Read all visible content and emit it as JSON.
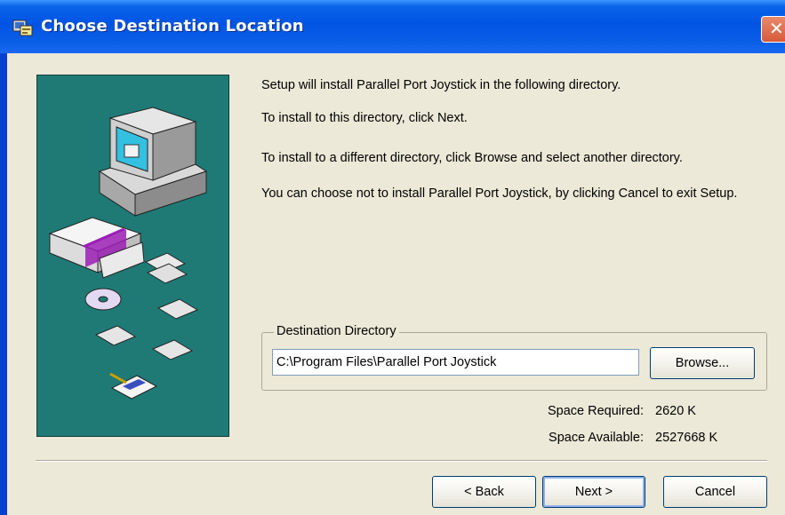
{
  "window": {
    "title": "Choose Destination Location",
    "close_glyph": "✕",
    "title_icon": "installer-icon"
  },
  "body": {
    "line1": "Setup will install Parallel Port Joystick in the following directory.",
    "line2": "To install to this directory, click Next.",
    "line3": "To install to a different directory, click Browse and select another directory.",
    "line4": "You can choose not to install Parallel Port Joystick, by clicking Cancel to exit Setup."
  },
  "destination": {
    "group_label": "Destination Directory",
    "path": "C:\\Program Files\\Parallel Port Joystick",
    "browse_label": "Browse..."
  },
  "space": {
    "required_label": "Space Required:",
    "required_value": "2620 K",
    "available_label": "Space Available:",
    "available_value": "2527668 K"
  },
  "buttons": {
    "back": "< Back",
    "next": "Next >",
    "cancel": "Cancel"
  },
  "colors": {
    "titlebar": "#0054e3",
    "art_background": "#1f7a76",
    "face": "#ece9d8"
  }
}
